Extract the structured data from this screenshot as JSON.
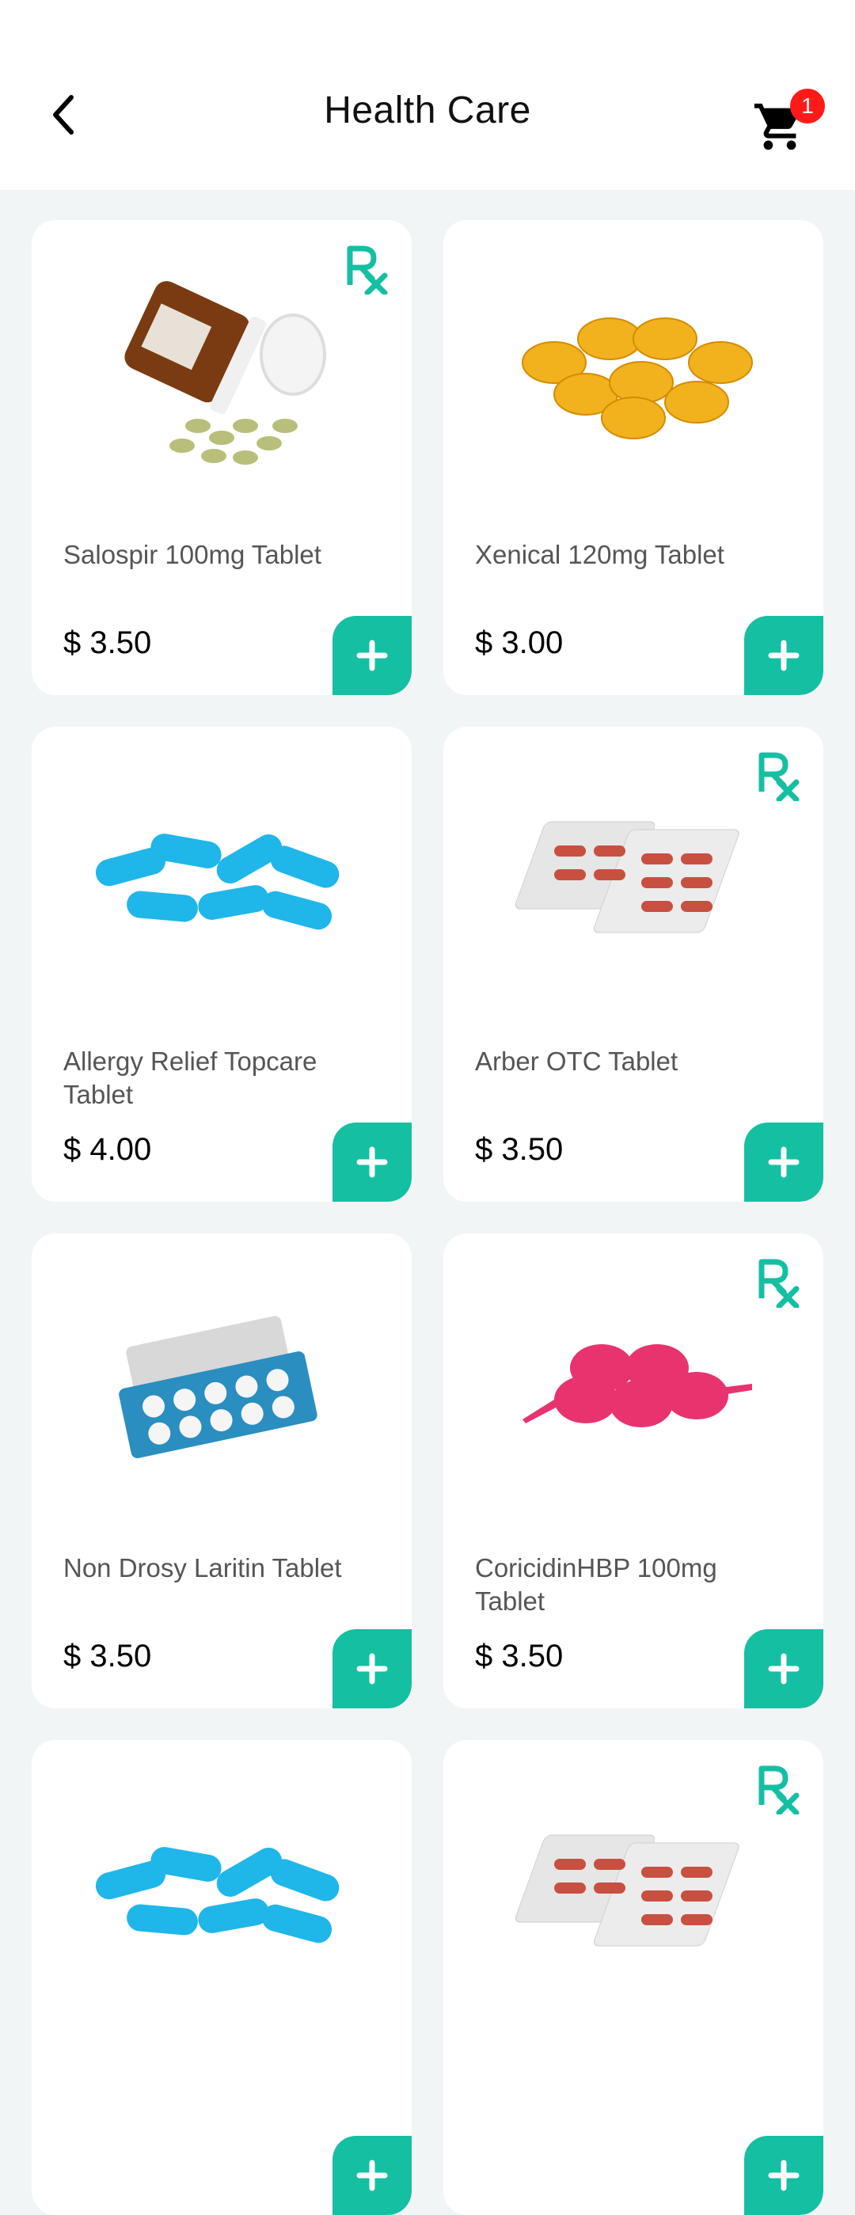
{
  "header": {
    "title": "Health Care",
    "cart_count": "1",
    "back_icon": "chevron-left-icon",
    "cart_icon": "cart-icon"
  },
  "colors": {
    "accent": "#15BFA2",
    "badge": "#FF1A1A",
    "background": "#F2F5F6"
  },
  "products": [
    {
      "name": "Salospir 100mg Tablet",
      "price": "$ 3.50",
      "rx": true,
      "image": "pill-bottle-spilled-tablets"
    },
    {
      "name": "Xenical 120mg Tablet",
      "price": "$ 3.00",
      "rx": false,
      "image": "yellow-softgel-capsules"
    },
    {
      "name": "Allergy Relief Topcare Tablet",
      "price": "$ 4.00",
      "rx": false,
      "image": "blue-capsules"
    },
    {
      "name": "Arber OTC Tablet",
      "price": "$ 3.50",
      "rx": true,
      "image": "red-capsule-blister-packs"
    },
    {
      "name": "Non Drosy Laritin Tablet",
      "price": "$ 3.50",
      "rx": false,
      "image": "white-tablet-blister-packs"
    },
    {
      "name": "CoricidinHBP 100mg Tablet",
      "price": "$ 3.50",
      "rx": true,
      "image": "pink-oil-capsules"
    },
    {
      "name": "",
      "price": "",
      "rx": false,
      "image": "blue-capsules"
    },
    {
      "name": "",
      "price": "",
      "rx": true,
      "image": "red-capsule-blister-packs"
    }
  ]
}
